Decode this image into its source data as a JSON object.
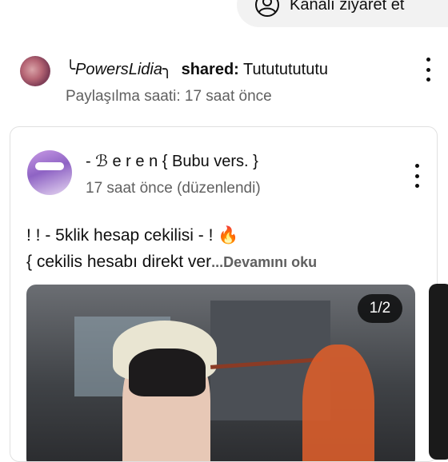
{
  "top": {
    "visit_channel_label": "Kanalı ziyaret et",
    "icon": "account-icon"
  },
  "share_header": {
    "username": "╰PowersLidia╮",
    "shared_label": "shared:",
    "shared_title": "Tutututututu",
    "shared_time": "Paylaşılma saati: 17 saat önce",
    "menu_icon": "more-vert-icon"
  },
  "post": {
    "author": "- ℬ e r e n { Bubu vers. }",
    "time": "17 saat önce (düzenlendi)",
    "text_line1": "! ! - 5klik hesap cekilisi - ! 🔥",
    "text_line2": "{ cekilis hesabı direkt ver",
    "more_label": "...Devamını oku",
    "image_counter": "1/2",
    "menu_icon": "more-vert-icon"
  }
}
